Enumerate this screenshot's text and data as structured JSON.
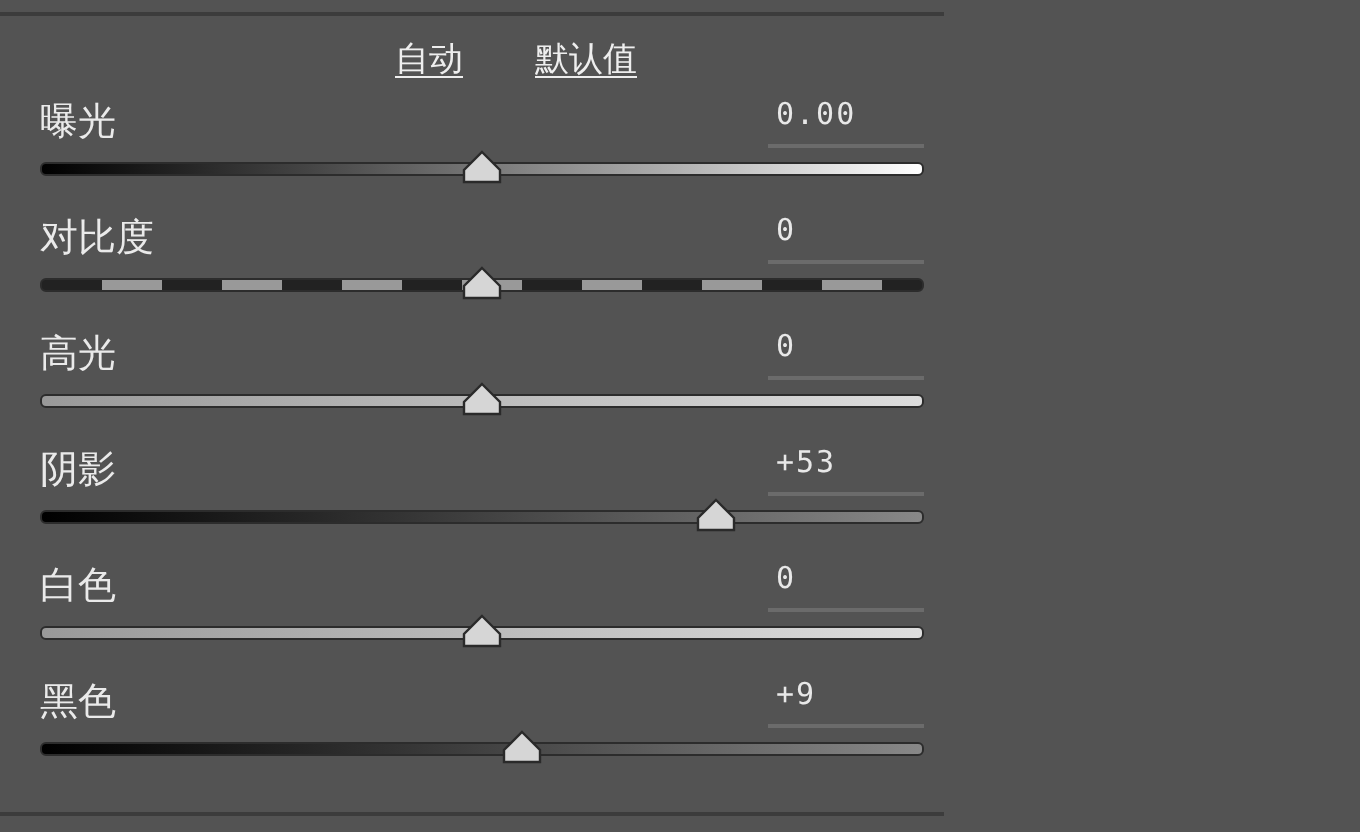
{
  "links": [
    "自动",
    "默认值"
  ],
  "sliders": [
    {
      "label": "曝光",
      "value": "0.00",
      "level": 0.5,
      "kind": "ramp"
    },
    {
      "label": "对比度",
      "value": "0",
      "level": 0.5,
      "kind": "dashes"
    },
    {
      "label": "高光",
      "value": "0",
      "level": 0.5,
      "kind": "light"
    },
    {
      "label": "阴影",
      "value": "+53",
      "level": 0.765,
      "kind": "dark"
    },
    {
      "label": "白色",
      "value": "0",
      "level": 0.5,
      "kind": "light"
    },
    {
      "label": "黑色",
      "value": "+9",
      "level": 0.545,
      "kind": "dark"
    }
  ]
}
